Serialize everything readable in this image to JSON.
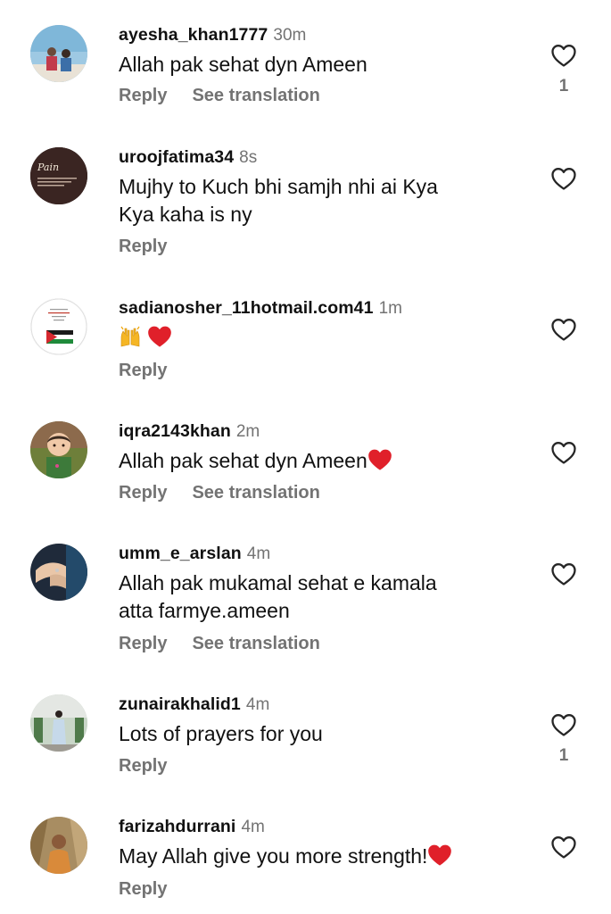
{
  "comments": [
    {
      "username": "ayesha_khan1777",
      "time": "30m",
      "lines": [
        "Allah pak sehat dyn Ameen"
      ],
      "reply": "Reply",
      "translate": "See translation",
      "likes": "1",
      "emoji": null
    },
    {
      "username": "uroojfatima34",
      "time": "8s",
      "lines": [
        "Mujhy to Kuch bhi samjh nhi ai Kya",
        "Kya kaha is ny"
      ],
      "reply": "Reply",
      "translate": "",
      "likes": "",
      "emoji": null
    },
    {
      "username": "sadianosher_11hotmail.com41",
      "time": "1m",
      "lines": [
        ""
      ],
      "reply": "Reply",
      "translate": "",
      "likes": "",
      "emoji": "raising-hands-red-heart"
    },
    {
      "username": "iqra2143khan",
      "time": "2m",
      "lines": [
        "Allah pak sehat dyn Ameen"
      ],
      "reply": "Reply",
      "translate": "See translation",
      "likes": "",
      "emoji": "trailing-red-heart"
    },
    {
      "username": "umm_e_arslan",
      "time": "4m",
      "lines": [
        "Allah pak mukamal sehat e kamala",
        "atta farmye.ameen"
      ],
      "reply": "Reply",
      "translate": "See translation",
      "likes": "",
      "emoji": null
    },
    {
      "username": "zunairakhalid1",
      "time": "4m",
      "lines": [
        "Lots of prayers for you"
      ],
      "reply": "Reply",
      "translate": "",
      "likes": "1",
      "emoji": null
    },
    {
      "username": "farizahdurrani",
      "time": "4m",
      "lines": [
        "May Allah give you more strength!"
      ],
      "reply": "Reply",
      "translate": "",
      "likes": "",
      "emoji": "trailing-red-heart"
    }
  ],
  "colors": {
    "text": "#111111",
    "secondary": "#737373",
    "heart_red": "#e0202a"
  }
}
